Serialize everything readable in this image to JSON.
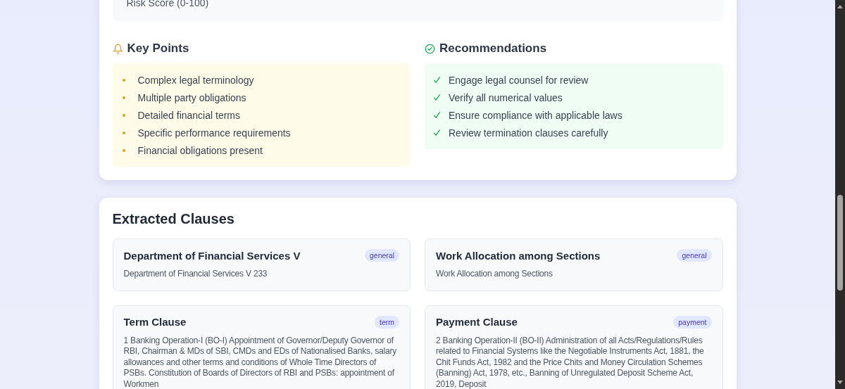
{
  "risk_panel": {
    "label": "Risk Score (0-100)"
  },
  "key_points": {
    "title": "Key Points",
    "items": [
      "Complex legal terminology",
      "Multiple party obligations",
      "Detailed financial terms",
      "Specific performance requirements",
      "Financial obligations present"
    ]
  },
  "recommendations": {
    "title": "Recommendations",
    "items": [
      "Engage legal counsel for review",
      "Verify all numerical values",
      "Ensure compliance with applicable laws",
      "Review termination clauses carefully"
    ]
  },
  "clauses": {
    "title": "Extracted Clauses",
    "items": [
      {
        "title": "Department of Financial Services V",
        "tag": "general",
        "text": "Department of Financial Services V 233"
      },
      {
        "title": "Work Allocation among Sections",
        "tag": "general",
        "text": "Work Allocation among Sections"
      },
      {
        "title": "Term Clause",
        "tag": "term",
        "text": "1 Banking Operation-I (BO-I) Appointment of Governor/Deputy Governor of RBI, Chairman & MDs of SBI, CMDs and EDs of Nationalised Banks, salary allowances and other terms and conditions of Whole Time Directors of PSBs. Constitution of Boards of Directors of RBI and PSBs: appointment of Workmen"
      },
      {
        "title": "Payment Clause",
        "tag": "payment",
        "text": "2 Banking Operation-II (BO-II) Administration of all Acts/Regulations/Rules related to Financial Systems like the Negotiable Instruments Act, 1881, the Chit Funds Act, 1982 and the Price Chits and Money Circulation Schemes (Banning) Act, 1978, etc., Banning of Unregulated Deposit Scheme Act, 2019, Deposit"
      }
    ]
  }
}
